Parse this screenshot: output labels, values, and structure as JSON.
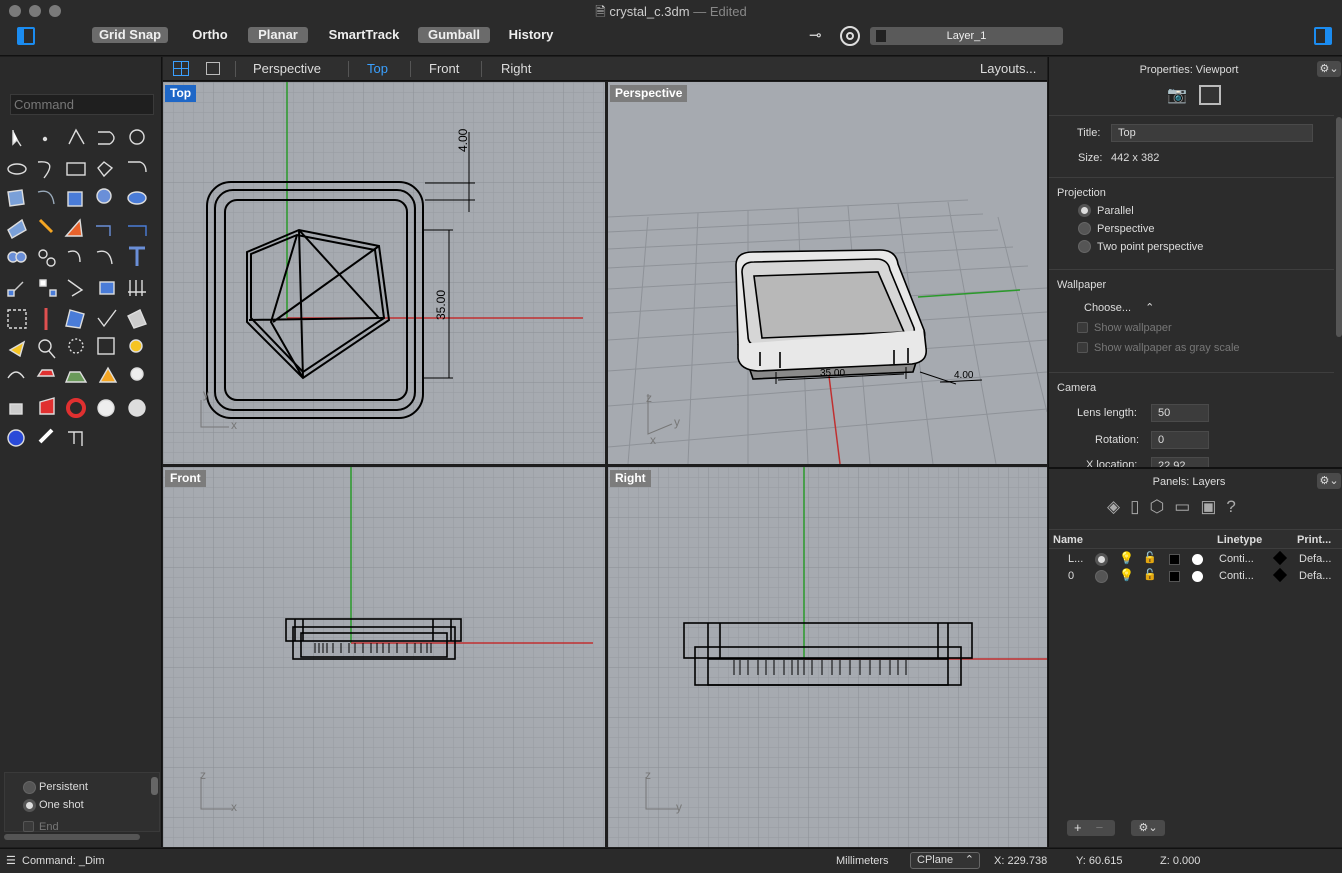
{
  "window": {
    "file_name": "crystal_c.3dm",
    "edited_suffix": "— Edited"
  },
  "toolbar": {
    "buttons": [
      {
        "label": "Grid Snap",
        "on": true
      },
      {
        "label": "Ortho",
        "on": false
      },
      {
        "label": "Planar",
        "on": true
      },
      {
        "label": "SmartTrack",
        "on": false
      },
      {
        "label": "Gumball",
        "on": true
      },
      {
        "label": "History",
        "on": false
      }
    ],
    "current_layer": "Layer_1"
  },
  "command": {
    "placeholder": "Command"
  },
  "viewport_tabs": {
    "tabs": [
      "Perspective",
      "Top",
      "Front",
      "Right"
    ],
    "active": "Top",
    "layouts_label": "Layouts..."
  },
  "viewports": {
    "top": {
      "label": "Top",
      "dim1": "4.00",
      "dim2": "35.00",
      "axis_x": "x",
      "axis_y": "y"
    },
    "perspective": {
      "label": "Perspective",
      "dim1": "35.00",
      "dim2": "4.00",
      "axis_z": "z",
      "axis_y": "y",
      "axis_x": "x"
    },
    "front": {
      "label": "Front",
      "axis_z": "z",
      "axis_x": "x"
    },
    "right": {
      "label": "Right",
      "axis_z": "z",
      "axis_y": "y"
    }
  },
  "osnap_panel": {
    "options": [
      {
        "label": "Persistent",
        "on": false
      },
      {
        "label": "One shot",
        "on": true
      },
      {
        "label": "End",
        "on": false
      }
    ]
  },
  "properties": {
    "header": "Properties: Viewport",
    "title_label": "Title:",
    "title_value": "Top",
    "size_label": "Size:",
    "size_value": "442 x 382",
    "projection_header": "Projection",
    "projection_options": [
      {
        "label": "Parallel",
        "on": true
      },
      {
        "label": "Perspective",
        "on": false
      },
      {
        "label": "Two point perspective",
        "on": false
      }
    ],
    "wallpaper_header": "Wallpaper",
    "choose_label": "Choose...",
    "show_wallpaper": "Show wallpaper",
    "show_gray": "Show wallpaper as gray scale",
    "camera_header": "Camera",
    "lens_label": "Lens length:",
    "lens_value": "50",
    "rotation_label": "Rotation:",
    "rotation_value": "0",
    "xloc_label": "X location:",
    "xloc_value": "22.92"
  },
  "layers": {
    "header": "Panels: Layers",
    "col_name": "Name",
    "col_linetype": "Linetype",
    "col_print": "Print...",
    "rows": [
      {
        "name": "L...",
        "current": true,
        "linetype": "Conti...",
        "print": "Defa...",
        "color": "#000000"
      },
      {
        "name": "0",
        "current": false,
        "linetype": "Conti...",
        "print": "Defa...",
        "color": "#000000"
      }
    ]
  },
  "status": {
    "command": "Command: _Dim",
    "units": "Millimeters",
    "cplane": "CPlane",
    "x": "X: 229.738",
    "y": "Y: 60.615",
    "z": "Z: 0.000"
  }
}
